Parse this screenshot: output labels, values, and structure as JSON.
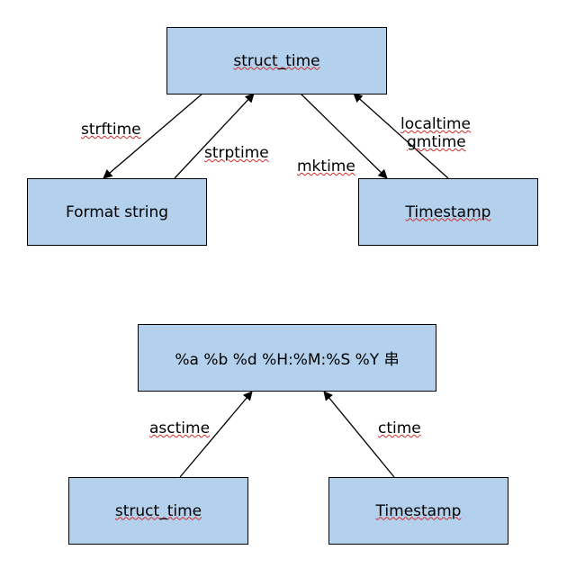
{
  "diagram1": {
    "top_box": "struct_time",
    "left_box": "Format string",
    "right_box": "Timestamp",
    "edge_left_down": "strftime",
    "edge_left_up": "strptime",
    "edge_right_down": "mktime",
    "edge_right_up_line1": "localtime",
    "edge_right_up_line2": "gmtime"
  },
  "diagram2": {
    "top_box": "%a %b %d %H:%M:%S %Y 串",
    "left_box": "struct_time",
    "right_box": "Timestamp",
    "edge_left": "asctime",
    "edge_right": "ctime"
  },
  "colors": {
    "box_fill": "#b3d0ec",
    "box_border": "#000000",
    "wavy_underline": "#d02a2a"
  }
}
